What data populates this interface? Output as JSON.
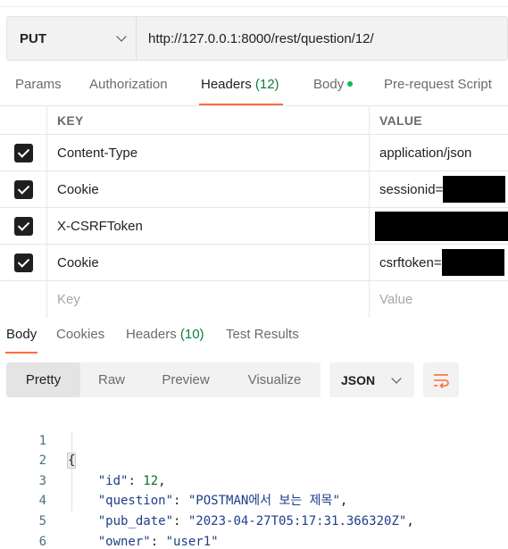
{
  "request": {
    "method": "PUT",
    "url": "http://127.0.0.1:8000/rest/question/12/"
  },
  "request_tabs": [
    {
      "label": "Params"
    },
    {
      "label": "Authorization"
    },
    {
      "label": "Headers",
      "count": "(12)",
      "active": true
    },
    {
      "label": "Body",
      "has_content": true
    },
    {
      "label": "Pre-request Script"
    }
  ],
  "headers_table": {
    "key_header": "KEY",
    "value_header": "VALUE",
    "rows": [
      {
        "key": "Content-Type",
        "value": "application/json",
        "checked": true
      },
      {
        "key": "Cookie",
        "value": "sessionid=",
        "checked": true,
        "redacted": true
      },
      {
        "key": "X-CSRFToken",
        "value": "",
        "checked": true,
        "redacted": true
      },
      {
        "key": "Cookie",
        "value": "csrftoken=",
        "checked": true,
        "redacted": true
      }
    ],
    "new_row": {
      "key_placeholder": "Key",
      "value_placeholder": "Value"
    }
  },
  "response_tabs": [
    {
      "label": "Body",
      "active": true
    },
    {
      "label": "Cookies"
    },
    {
      "label": "Headers",
      "count": "(10)"
    },
    {
      "label": "Test Results"
    }
  ],
  "view_modes": [
    "Pretty",
    "Raw",
    "Preview",
    "Visualize"
  ],
  "active_view_mode": "Pretty",
  "format": "JSON",
  "icons": {
    "method_dropdown": "chevron-down-icon",
    "format_dropdown": "chevron-down-icon",
    "wrap": "wrap-lines-icon",
    "checkbox": "checkbox-checked-icon"
  },
  "colors": {
    "accent": "#ff6c37",
    "count": "#0c7d3f",
    "body_dot": "#0cbb52",
    "json_key": "#1d3e8a",
    "json_number": "#0c6e2e"
  },
  "response_body": {
    "line_numbers": [
      "1",
      "2",
      "3",
      "4",
      "5",
      "6"
    ],
    "open_brace": "{",
    "close_brace": "}",
    "fields": [
      {
        "key": "\"id\"",
        "value": "12",
        "type": "number",
        "comma": ","
      },
      {
        "key": "\"question\"",
        "value": "\"POSTMAN에서 보는 제목\"",
        "type": "string",
        "comma": ","
      },
      {
        "key": "\"pub_date\"",
        "value": "\"2023-04-27T05:17:31.366320Z\"",
        "type": "string",
        "comma": ","
      },
      {
        "key": "\"owner\"",
        "value": "\"user1\"",
        "type": "string",
        "comma": ""
      }
    ]
  }
}
